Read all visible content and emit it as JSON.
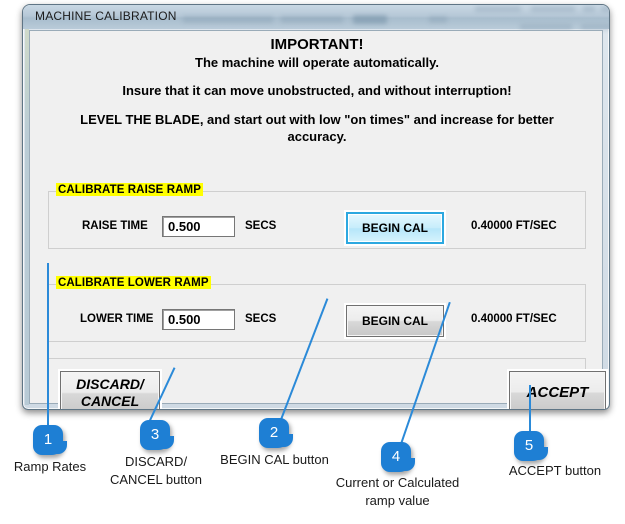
{
  "window": {
    "title": "MACHINE CALIBRATION"
  },
  "warning": {
    "heading": "IMPORTANT!",
    "line1": "The machine will operate automatically.",
    "line2": "Insure that it can move unobstructed, and without interruption!",
    "line3": "LEVEL THE BLADE, and start out with low \"on times\" and increase for better",
    "line4": "accuracy."
  },
  "raise_section": {
    "legend": "CALIBRATE RAISE RAMP",
    "field_label": "RAISE TIME",
    "value": "0.500",
    "units": "SECS",
    "button_label": "BEGIN CAL",
    "ramp_value": "0.40000 FT/SEC"
  },
  "lower_section": {
    "legend": "CALIBRATE LOWER RAMP",
    "field_label": "LOWER TIME",
    "value": "0.500",
    "units": "SECS",
    "button_label": "BEGIN CAL",
    "ramp_value": "0.40000 FT/SEC"
  },
  "actions": {
    "discard_line1": "DISCARD/",
    "discard_line2": "CANCEL",
    "accept_label": "ACCEPT"
  },
  "callouts": [
    {
      "number": "1",
      "caption": "Ramp Rates"
    },
    {
      "number": "3",
      "caption": "DISCARD/\nCANCEL button"
    },
    {
      "number": "2",
      "caption": "BEGIN CAL button"
    },
    {
      "number": "4",
      "caption": "Current or Calculated\nramp value"
    },
    {
      "number": "5",
      "caption": "ACCEPT  button"
    }
  ],
  "colors": {
    "callout_blue": "#1e7fd4",
    "leader_blue": "#2b8ad8",
    "legend_highlight": "#ffff00",
    "focus_button_border": "#2ca8e0"
  }
}
